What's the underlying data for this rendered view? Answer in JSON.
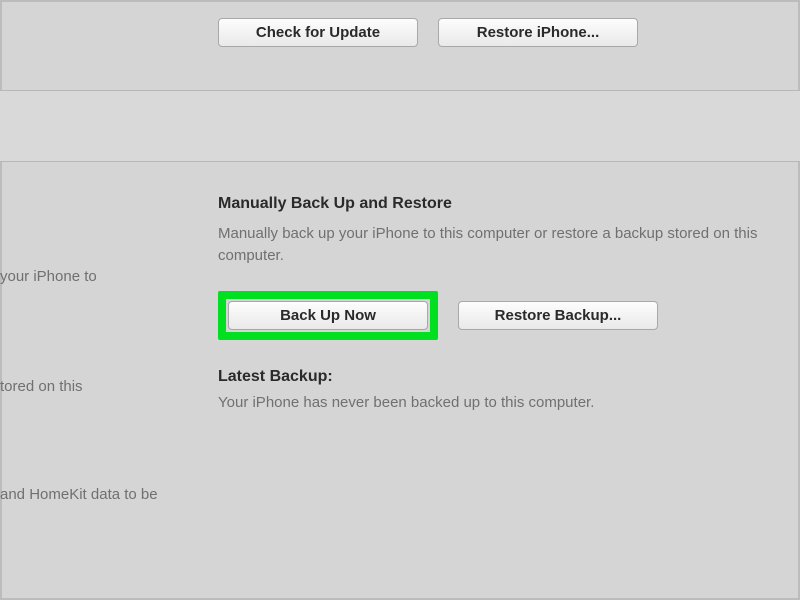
{
  "top": {
    "check_update_label": "Check for Update",
    "restore_iphone_label": "Restore iPhone..."
  },
  "backup_section": {
    "title": "Manually Back Up and Restore",
    "description": "Manually back up your iPhone to this computer or restore a backup stored on this computer.",
    "back_up_now_label": "Back Up Now",
    "restore_backup_label": "Restore Backup...",
    "latest_label": "Latest Backup:",
    "latest_status": "Your iPhone has never been backed up to this computer."
  },
  "left_fragments": {
    "frag1": "your iPhone to",
    "frag2": "tored on this",
    "frag3": " and HomeKit data to be"
  }
}
